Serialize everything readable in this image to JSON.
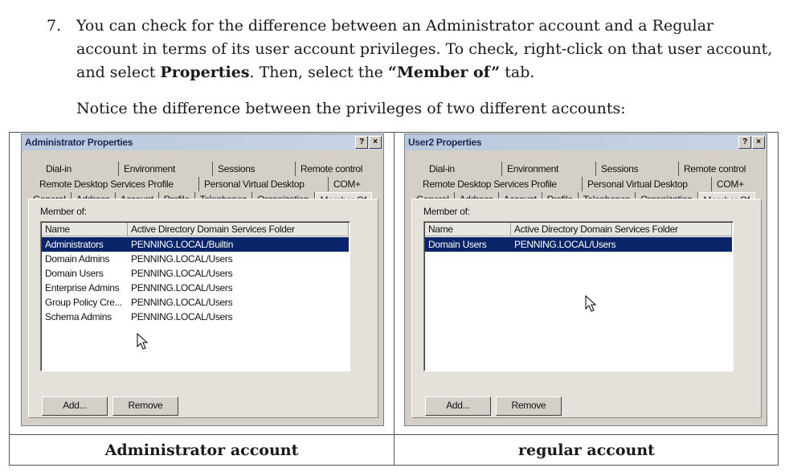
{
  "instruction": {
    "number": "7.",
    "text_before": "You can check for the difference between an Administrator account and a Regular account in terms of its user account privileges. To check, right-click on that user account, and select ",
    "bold1": "Properties",
    "text_middle": ". Then, select the ",
    "bold2": "“Member of”",
    "text_after": " tab."
  },
  "notice": "Notice the difference between the privileges of two different accounts:",
  "captions": {
    "left": "Administrator account",
    "right": "regular account"
  },
  "title_buttons": {
    "help": "?",
    "close": "×"
  },
  "dialogs": [
    {
      "title": "Administrator Properties",
      "tabs_row1": [
        "Dial-in",
        "Environment",
        "Sessions",
        "Remote control"
      ],
      "tabs_row2": [
        "Remote Desktop Services Profile",
        "Personal Virtual Desktop",
        "COM+"
      ],
      "tabs_row3": [
        "General",
        "Address",
        "Account",
        "Profile",
        "Telephones",
        "Organization",
        "Member Of"
      ],
      "member_of_label": "Member of:",
      "columns": [
        "Name",
        "Active Directory Domain Services Folder"
      ],
      "rows": [
        [
          "Administrators",
          "PENNING.LOCAL/Builtin"
        ],
        [
          "Domain Admins",
          "PENNING.LOCAL/Users"
        ],
        [
          "Domain Users",
          "PENNING.LOCAL/Users"
        ],
        [
          "Enterprise Admins",
          "PENNING.LOCAL/Users"
        ],
        [
          "Group Policy Cre...",
          "PENNING.LOCAL/Users"
        ],
        [
          "Schema Admins",
          "PENNING.LOCAL/Users"
        ]
      ],
      "add_button": "Add...",
      "remove_button": "Remove"
    },
    {
      "title": "User2 Properties",
      "tabs_row1": [
        "Dial-in",
        "Environment",
        "Sessions",
        "Remote control"
      ],
      "tabs_row2": [
        "Remote Desktop Services Profile",
        "Personal Virtual Desktop",
        "COM+"
      ],
      "tabs_row3": [
        "General",
        "Address",
        "Account",
        "Profile",
        "Telephones",
        "Organization",
        "Member Of"
      ],
      "member_of_label": "Member of:",
      "columns": [
        "Name",
        "Active Directory Domain Services Folder"
      ],
      "rows": [
        [
          "Domain Users",
          "PENNING.LOCAL/Users"
        ]
      ],
      "add_button": "Add...",
      "remove_button": "Remove"
    }
  ],
  "icons": {
    "cursor": "mouse-pointer-icon"
  },
  "colors": {
    "selection": "#0a246a",
    "dialog_bg": "#d4d0c8",
    "titlebar_text": "#1e2a55"
  }
}
